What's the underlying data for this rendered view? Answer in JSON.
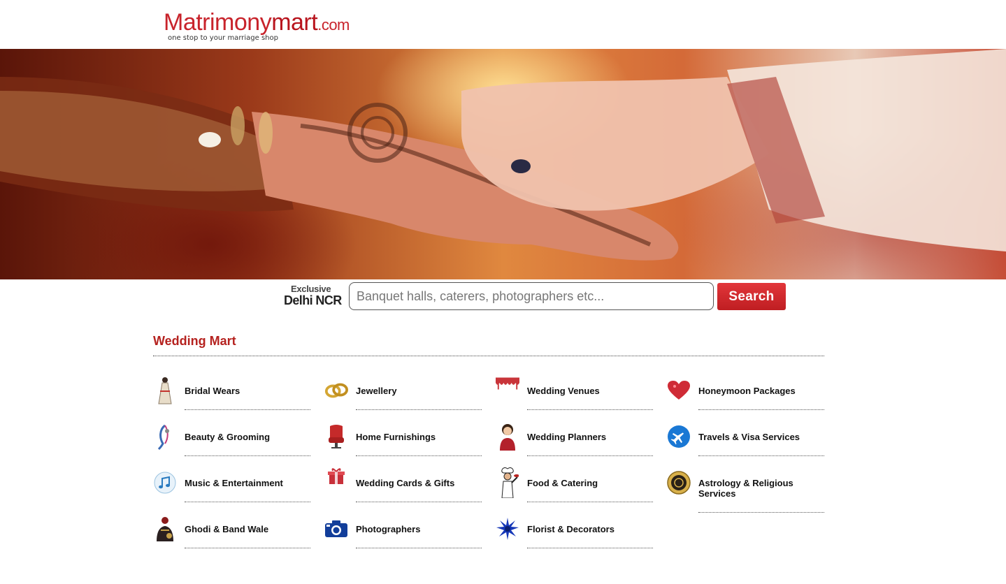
{
  "logo": {
    "name_part1": "Matrimony",
    "name_part2": "mart",
    "domain": ".com",
    "tagline": "one stop to your marriage shop"
  },
  "search": {
    "exclusive_label": "Exclusive",
    "region_label": "Delhi NCR",
    "placeholder": "Banquet halls, caterers, photographers etc...",
    "value": "",
    "button_label": "Search"
  },
  "section": {
    "title": "Wedding Mart"
  },
  "categories": [
    {
      "label": "Bridal Wears",
      "icon": "bride-icon"
    },
    {
      "label": "Jewellery",
      "icon": "rings-icon"
    },
    {
      "label": "Wedding Venues",
      "icon": "venue-icon"
    },
    {
      "label": "Honeymoon Packages",
      "icon": "heart-icon"
    },
    {
      "label": "Beauty & Grooming",
      "icon": "beauty-icon"
    },
    {
      "label": "Home Furnishings",
      "icon": "chair-icon"
    },
    {
      "label": "Wedding Planners",
      "icon": "planner-icon"
    },
    {
      "label": "Travels & Visa Services",
      "icon": "airplane-icon"
    },
    {
      "label": "Music & Entertainment",
      "icon": "music-note-icon"
    },
    {
      "label": "Wedding Cards & Gifts",
      "icon": "gift-icon"
    },
    {
      "label": "Food & Catering",
      "icon": "chef-icon"
    },
    {
      "label": "Astrology & Religious Services",
      "icon": "astrology-icon"
    },
    {
      "label": "Ghodi & Band Wale",
      "icon": "horse-icon"
    },
    {
      "label": "Photographers",
      "icon": "camera-icon"
    },
    {
      "label": "Florist & Decorators",
      "icon": "flower-icon"
    }
  ],
  "colors": {
    "brand_red": "#c8232b",
    "section_title": "#b5221f",
    "search_button": "#d02a2e"
  }
}
